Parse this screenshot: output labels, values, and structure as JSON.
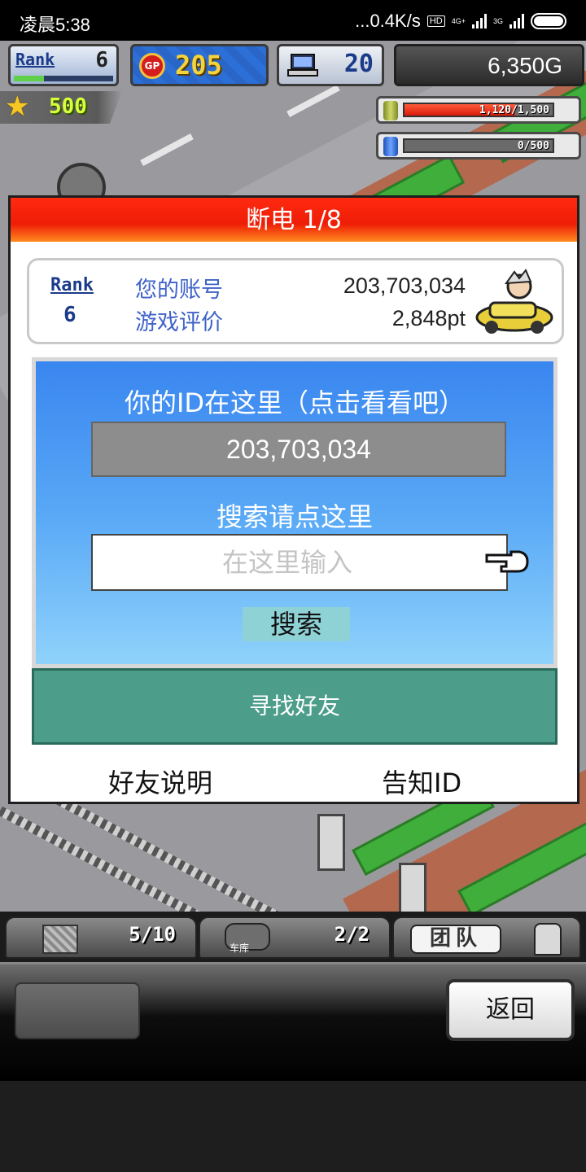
{
  "status_bar": {
    "time": "凌晨5:38",
    "net_speed": "...0.4K/s",
    "hd": "HD",
    "net1": "4G+",
    "net2": "3G"
  },
  "hud": {
    "rank_label": "Rank",
    "rank_value": "6",
    "gp_icon_text": "GP",
    "gp_value": "205",
    "pc_value": "20",
    "money": "6,350G",
    "stars": "500",
    "meter1_text": "1,120/1,500",
    "meter1_fraction": 0.747,
    "meter2_text": "0/500",
    "meter2_fraction": 0
  },
  "dialog": {
    "title": "断电 1/8",
    "account": {
      "rank_label": "Rank",
      "rank_value": "6",
      "account_label": "您的账号",
      "account_value": "203,703,034",
      "rating_label": "游戏评价",
      "rating_value": "2,848pt"
    },
    "search": {
      "id_prompt": "你的ID在这里（点击看看吧）",
      "your_id": "203,703,034",
      "search_prompt": "搜索请点这里",
      "input_placeholder": "在这里输入",
      "search_button": "搜索"
    },
    "find_friends": "寻找好友",
    "friend_help": "好友说明",
    "tell_id": "告知ID"
  },
  "bottom": {
    "tab1_value": "5/10",
    "tab2_label": "车库",
    "tab2_value": "2/2",
    "tab3_label": "团队",
    "back": "返回"
  }
}
